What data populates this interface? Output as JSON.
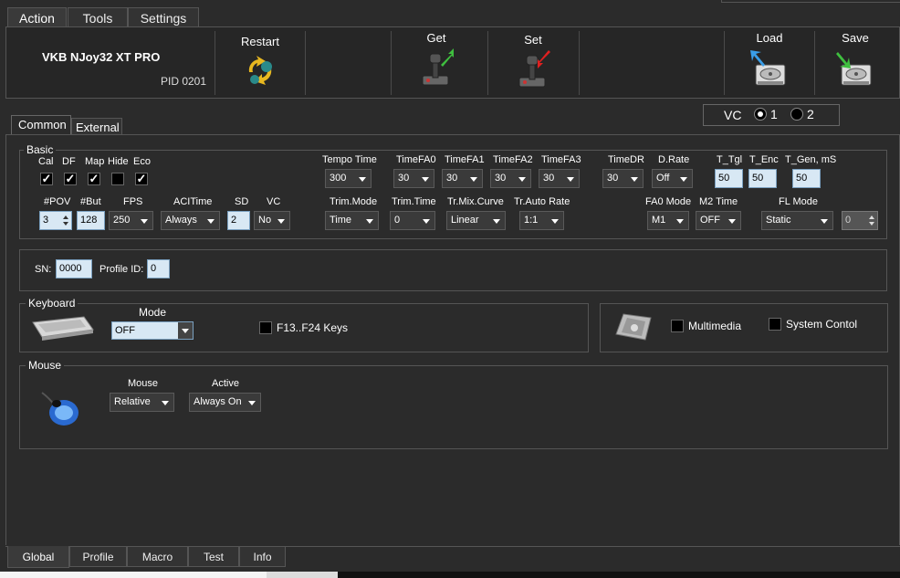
{
  "menu_tabs": [
    "Action",
    "Tools",
    "Settings"
  ],
  "device": {
    "name": "VKB NJoy32 XT PRO",
    "pid": "PID 0201"
  },
  "toolbar": {
    "restart": "Restart",
    "get": "Get",
    "set": "Set",
    "load": "Load",
    "save": "Save"
  },
  "vc_selector": {
    "label": "VC",
    "option1": "1",
    "option2": "2",
    "selected": "1"
  },
  "content_tabs": [
    "Common",
    "External"
  ],
  "basic": {
    "title": "Basic",
    "checks": [
      {
        "label": "Cal",
        "checked": true
      },
      {
        "label": "DF",
        "checked": true
      },
      {
        "label": "Map",
        "checked": true
      },
      {
        "label": "Hide",
        "checked": false
      },
      {
        "label": "Eco",
        "checked": true
      }
    ],
    "row1": {
      "tempo_time": {
        "label": "Tempo Time",
        "value": "300"
      },
      "timefa0": {
        "label": "TimeFA0",
        "value": "30"
      },
      "timefa1": {
        "label": "TimeFA1",
        "value": "30"
      },
      "timefa2": {
        "label": "TimeFA2",
        "value": "30"
      },
      "timefa3": {
        "label": "TimeFA3",
        "value": "30"
      },
      "timedr": {
        "label": "TimeDR",
        "value": "30"
      },
      "drate": {
        "label": "D.Rate",
        "value": "Off"
      },
      "t_tgl": {
        "label": "T_Tgl",
        "value": "50"
      },
      "t_enc": {
        "label": "T_Enc",
        "value": "50"
      },
      "t_gen": {
        "label": "T_Gen, mS",
        "value": "50"
      }
    },
    "row2": {
      "pov": {
        "label": "#POV",
        "value": "3"
      },
      "but": {
        "label": "#But",
        "value": "128"
      },
      "fps": {
        "label": "FPS",
        "value": "250"
      },
      "acitime": {
        "label": "ACITime",
        "value": "Always"
      },
      "sd": {
        "label": "SD",
        "value": "2"
      },
      "vc": {
        "label": "VC",
        "value": "No"
      },
      "trim_mode": {
        "label": "Trim.Mode",
        "value": "Time"
      },
      "trim_time": {
        "label": "Trim.Time",
        "value": "0"
      },
      "tr_mix_curve": {
        "label": "Tr.Mix.Curve",
        "value": "Linear"
      },
      "tr_auto_rate": {
        "label": "Tr.Auto Rate",
        "value": "1:1"
      },
      "fa0_mode": {
        "label": "FA0 Mode",
        "value": "M1"
      },
      "m2_time": {
        "label": "M2 Time",
        "value": "OFF"
      },
      "fl_mode": {
        "label": "FL Mode",
        "value": "Static"
      },
      "fl_value": "0"
    }
  },
  "sn": {
    "label": "SN:",
    "value": "0000",
    "profile_label": "Profile ID:",
    "profile_value": "0"
  },
  "keyboard": {
    "title": "Keyboard",
    "mode_label": "Mode",
    "mode_value": "OFF",
    "f13_label": "F13..F24 Keys",
    "multimedia_label": "Multimedia",
    "system_label": "System Contol"
  },
  "mouse": {
    "title": "Mouse",
    "mouse_label": "Mouse",
    "mouse_value": "Relative",
    "active_label": "Active",
    "active_value": "Always On"
  },
  "bottom_tabs": [
    "Global",
    "Profile",
    "Macro",
    "Test",
    "Info"
  ],
  "colors": {
    "background": "#2b2b2b",
    "input_bg": "#d8e8f4",
    "accent_green": "#3fbf3f",
    "accent_red": "#e02020",
    "accent_blue": "#3a9ee8"
  }
}
